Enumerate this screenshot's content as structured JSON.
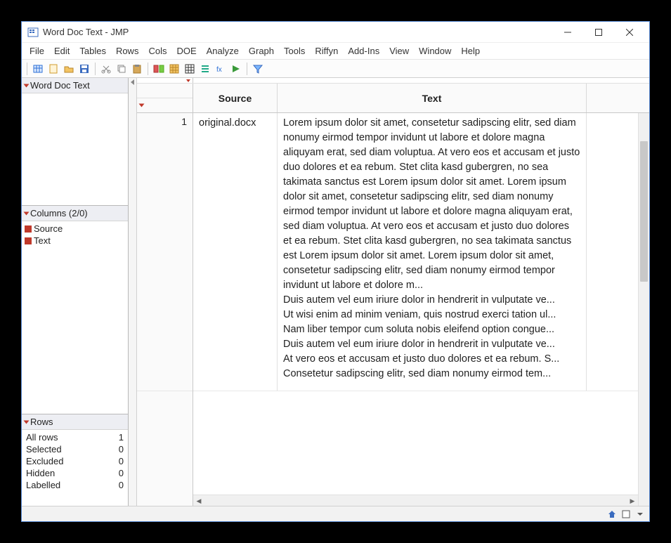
{
  "window": {
    "title": "Word Doc Text - JMP"
  },
  "menu": [
    "File",
    "Edit",
    "Tables",
    "Rows",
    "Cols",
    "DOE",
    "Analyze",
    "Graph",
    "Tools",
    "Riffyn",
    "Add-Ins",
    "View",
    "Window",
    "Help"
  ],
  "sidebar": {
    "tableName": "Word Doc Text",
    "columnsHeader": "Columns (2/0)",
    "columns": [
      "Source",
      "Text"
    ],
    "rowsHeader": "Rows",
    "rows": [
      {
        "label": "All rows",
        "value": "1"
      },
      {
        "label": "Selected",
        "value": "0"
      },
      {
        "label": "Excluded",
        "value": "0"
      },
      {
        "label": "Hidden",
        "value": "0"
      },
      {
        "label": "Labelled",
        "value": "0"
      }
    ]
  },
  "grid": {
    "headers": [
      "Source",
      "Text"
    ],
    "rowNum": "1",
    "source": "original.docx",
    "text": "Lorem ipsum dolor sit amet, consetetur sadipscing elitr,  sed diam nonumy eirmod tempor invidunt ut labore et dolore magna aliquyam erat, sed diam voluptua. At vero eos et accusam et justo duo dolores et ea rebum. Stet clita kasd gubergren, no sea takimata sanctus est Lorem ipsum dolor sit amet. Lorem ipsum dolor sit amet, consetetur sadipscing elitr,  sed diam nonumy eirmod tempor invidunt ut labore et dolore magna aliquyam erat, sed diam voluptua. At vero eos et accusam et justo duo dolores et ea rebum. Stet clita kasd gubergren, no sea takimata sanctus est Lorem ipsum dolor sit amet. Lorem ipsum dolor sit amet, consetetur sadipscing elitr,  sed diam nonumy eirmod tempor invidunt ut labore et dolore m...\nDuis autem vel eum iriure dolor in hendrerit in vulputate ve...\nUt wisi enim ad minim veniam, quis nostrud exerci tation ul...\nNam liber tempor cum soluta nobis eleifend option congue...\nDuis autem vel eum iriure dolor in hendrerit in vulputate ve...\nAt vero eos et accusam et justo duo dolores et ea rebum. S...\nConsetetur sadipscing elitr,  sed diam nonumy eirmod tem..."
  }
}
